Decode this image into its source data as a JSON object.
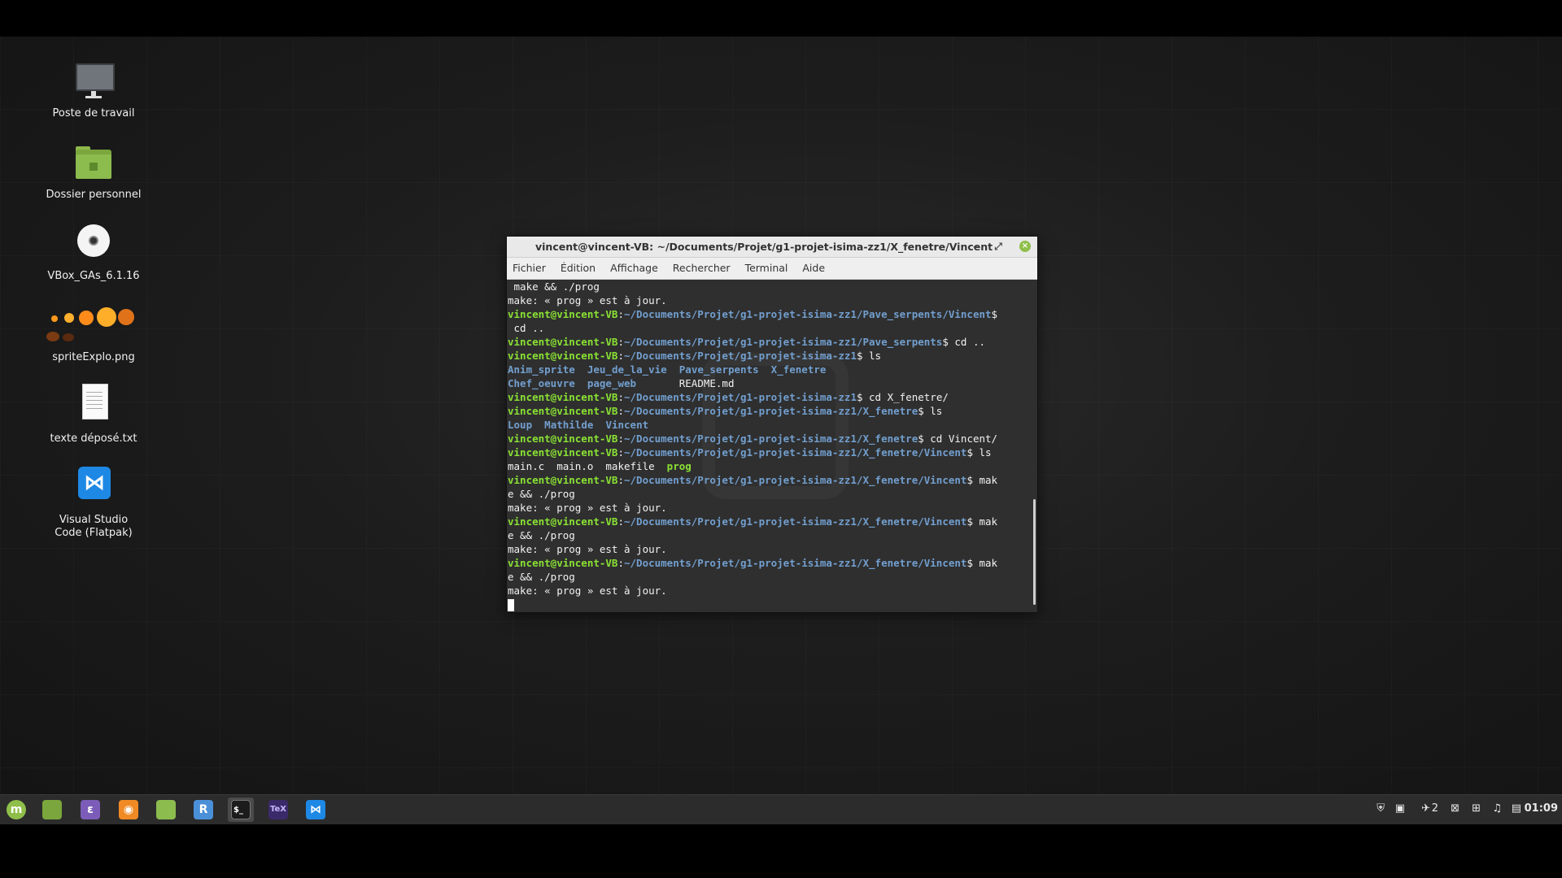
{
  "desktop": {
    "icons": [
      {
        "label": "Poste de travail",
        "icon": "computer-icon"
      },
      {
        "label": "Dossier personnel",
        "icon": "home-folder-icon"
      },
      {
        "label": "VBox_GAs_6.1.16",
        "icon": "optical-disc-icon"
      },
      {
        "label": "spriteExplo.png",
        "icon": "explosion-image-icon"
      },
      {
        "label": "texte déposé.txt",
        "icon": "text-file-icon"
      },
      {
        "label": "Visual Studio\nCode (Flatpak)",
        "icon": "vscode-icon"
      }
    ]
  },
  "terminal": {
    "title": "vincent@vincent-VB: ~/Documents/Projet/g1-projet-isima-zz1/X_fenetre/Vincent",
    "menu": [
      "Fichier",
      "Édition",
      "Affichage",
      "Rechercher",
      "Terminal",
      "Aide"
    ],
    "user_host": "vincent@vincent-VB",
    "lines": [
      [
        {
          "t": " make && ./prog"
        }
      ],
      [
        {
          "t": "make: « prog » est à jour."
        }
      ],
      [
        {
          "t": "vincent@vincent-VB",
          "c": "pu"
        },
        {
          "t": ":"
        },
        {
          "t": "~/Documents/Projet/g1-projet-isima-zz1/Pave_serpents/Vincent",
          "c": "pp"
        },
        {
          "t": "$"
        }
      ],
      [
        {
          "t": " cd .."
        }
      ],
      [
        {
          "t": "vincent@vincent-VB",
          "c": "pu"
        },
        {
          "t": ":"
        },
        {
          "t": "~/Documents/Projet/g1-projet-isima-zz1/Pave_serpents",
          "c": "pp"
        },
        {
          "t": "$ cd .."
        }
      ],
      [
        {
          "t": "vincent@vincent-VB",
          "c": "pu"
        },
        {
          "t": ":"
        },
        {
          "t": "~/Documents/Projet/g1-projet-isima-zz1",
          "c": "pp"
        },
        {
          "t": "$ ls"
        }
      ],
      [
        {
          "t": "Anim_sprite",
          "c": "dir"
        },
        {
          "t": "  "
        },
        {
          "t": "Jeu_de_la_vie",
          "c": "dir"
        },
        {
          "t": "  "
        },
        {
          "t": "Pave_serpents",
          "c": "dir"
        },
        {
          "t": "  "
        },
        {
          "t": "X_fenetre",
          "c": "dir"
        }
      ],
      [
        {
          "t": "Chef_oeuvre",
          "c": "dir"
        },
        {
          "t": "  "
        },
        {
          "t": "page_web",
          "c": "dir"
        },
        {
          "t": "       README.md"
        }
      ],
      [
        {
          "t": "vincent@vincent-VB",
          "c": "pu"
        },
        {
          "t": ":"
        },
        {
          "t": "~/Documents/Projet/g1-projet-isima-zz1",
          "c": "pp"
        },
        {
          "t": "$ cd X_fenetre/"
        }
      ],
      [
        {
          "t": "vincent@vincent-VB",
          "c": "pu"
        },
        {
          "t": ":"
        },
        {
          "t": "~/Documents/Projet/g1-projet-isima-zz1/X_fenetre",
          "c": "pp"
        },
        {
          "t": "$ ls"
        }
      ],
      [
        {
          "t": "Loup",
          "c": "dir"
        },
        {
          "t": "  "
        },
        {
          "t": "Mathilde",
          "c": "dir"
        },
        {
          "t": "  "
        },
        {
          "t": "Vincent",
          "c": "dir"
        }
      ],
      [
        {
          "t": "vincent@vincent-VB",
          "c": "pu"
        },
        {
          "t": ":"
        },
        {
          "t": "~/Documents/Projet/g1-projet-isima-zz1/X_fenetre",
          "c": "pp"
        },
        {
          "t": "$ cd Vincent/"
        }
      ],
      [
        {
          "t": "vincent@vincent-VB",
          "c": "pu"
        },
        {
          "t": ":"
        },
        {
          "t": "~/Documents/Projet/g1-projet-isima-zz1/X_fenetre/Vincent",
          "c": "pp"
        },
        {
          "t": "$ ls"
        }
      ],
      [
        {
          "t": "main.c  main.o  makefile  "
        },
        {
          "t": "prog",
          "c": "exe"
        }
      ],
      [
        {
          "t": "vincent@vincent-VB",
          "c": "pu"
        },
        {
          "t": ":"
        },
        {
          "t": "~/Documents/Projet/g1-projet-isima-zz1/X_fenetre/Vincent",
          "c": "pp"
        },
        {
          "t": "$ mak"
        }
      ],
      [
        {
          "t": "e && ./prog"
        }
      ],
      [
        {
          "t": "make: « prog » est à jour."
        }
      ],
      [
        {
          "t": "vincent@vincent-VB",
          "c": "pu"
        },
        {
          "t": ":"
        },
        {
          "t": "~/Documents/Projet/g1-projet-isima-zz1/X_fenetre/Vincent",
          "c": "pp"
        },
        {
          "t": "$ mak"
        }
      ],
      [
        {
          "t": "e && ./prog"
        }
      ],
      [
        {
          "t": "make: « prog » est à jour."
        }
      ],
      [
        {
          "t": "vincent@vincent-VB",
          "c": "pu"
        },
        {
          "t": ":"
        },
        {
          "t": "~/Documents/Projet/g1-projet-isima-zz1/X_fenetre/Vincent",
          "c": "pp"
        },
        {
          "t": "$ mak"
        }
      ],
      [
        {
          "t": "e && ./prog"
        }
      ],
      [
        {
          "t": "make: « prog » est à jour."
        }
      ]
    ]
  },
  "taskbar": {
    "apps": [
      {
        "name": "menu-button",
        "icon": "mint-menu-icon",
        "glyph": "m",
        "color": "#8fbf4a"
      },
      {
        "name": "show-desktop",
        "icon": "desktop-icon",
        "glyph": "",
        "color": "#7aa63d"
      },
      {
        "name": "emacs",
        "icon": "emacs-icon",
        "glyph": "ε",
        "color": "#7b5cb8"
      },
      {
        "name": "firefox",
        "icon": "firefox-icon",
        "glyph": "◉",
        "color": "#f08a24"
      },
      {
        "name": "files",
        "icon": "files-folder-icon",
        "glyph": "",
        "color": "#8cbb4e"
      },
      {
        "name": "rstudio",
        "icon": "r-icon",
        "glyph": "R",
        "color": "#4a90d9"
      },
      {
        "name": "terminal",
        "icon": "terminal-icon",
        "glyph": "$_",
        "color": "#1c1c1c"
      },
      {
        "name": "texmaker",
        "icon": "tex-icon",
        "glyph": "TeX",
        "color": "#3a2a6a"
      },
      {
        "name": "vscode",
        "icon": "vscode-icon",
        "glyph": "⋈",
        "color": "#1e88e5"
      }
    ],
    "tray": {
      "workspace_count": "2",
      "clock": "01:09"
    }
  }
}
